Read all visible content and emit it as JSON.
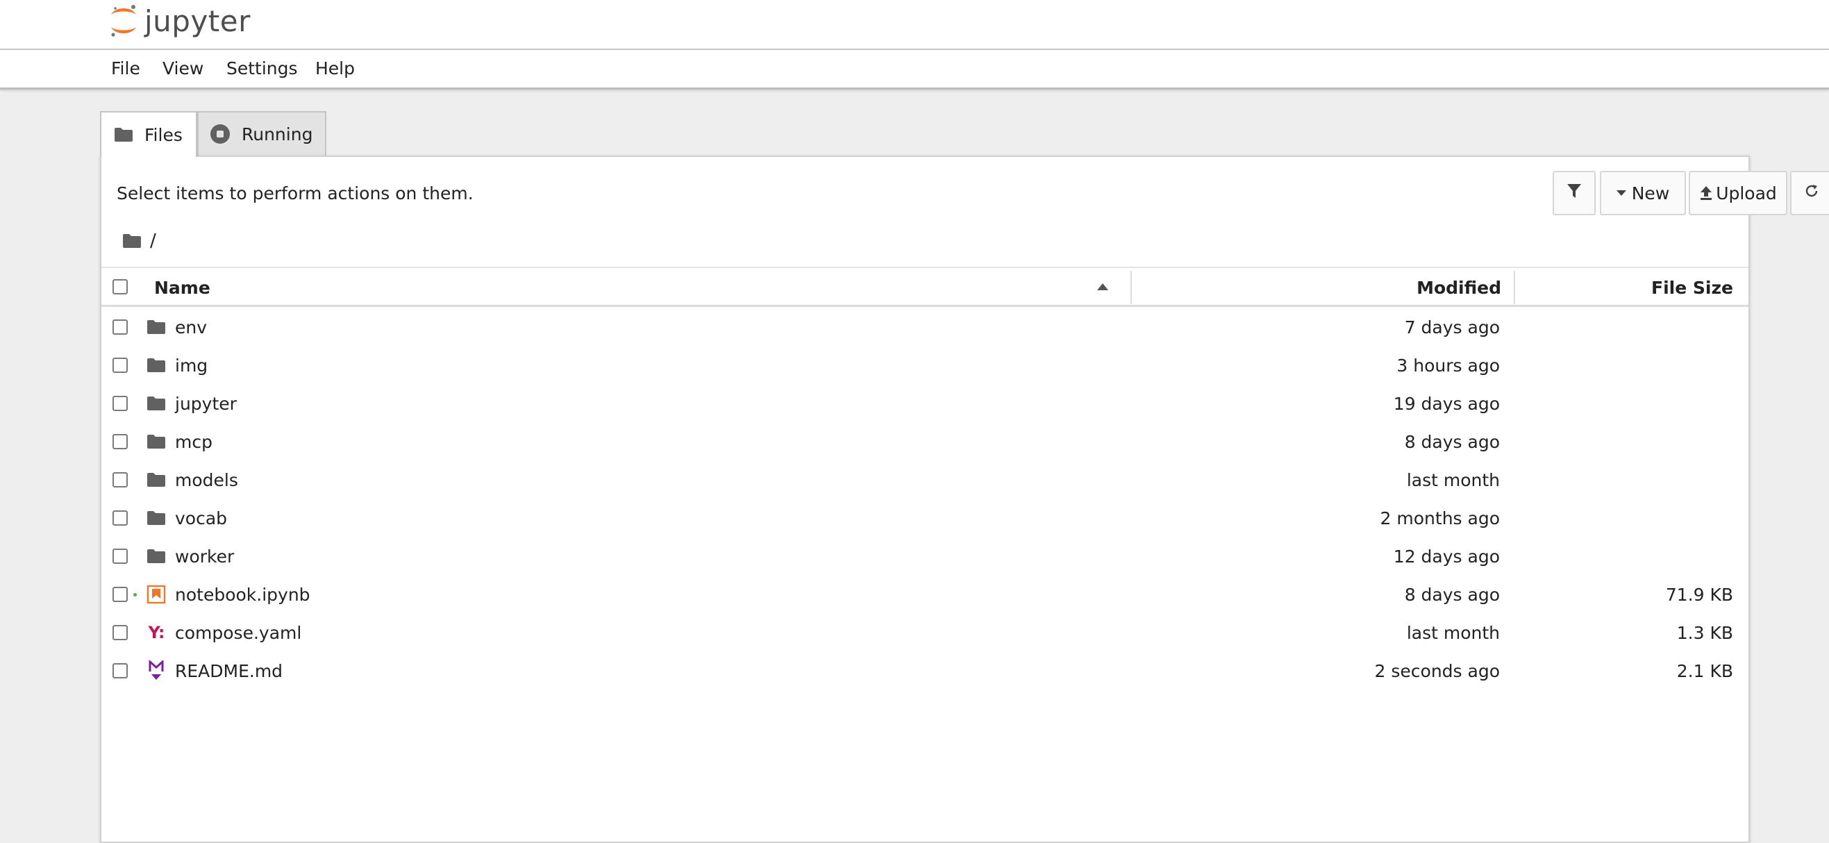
{
  "app": {
    "logo_text": "jupyter"
  },
  "menu": [
    "File",
    "View",
    "Settings",
    "Help"
  ],
  "tabs": [
    {
      "label": "Files",
      "icon": "folder-icon",
      "active": true
    },
    {
      "label": "Running",
      "icon": "stop-circle-icon",
      "active": false
    }
  ],
  "toolbar": {
    "hint": "Select items to perform actions on them.",
    "new_label": "New",
    "upload_label": "Upload"
  },
  "breadcrumb": {
    "path": "/"
  },
  "table": {
    "headers": {
      "name": "Name",
      "modified": "Modified",
      "size": "File Size"
    },
    "sort": {
      "column": "name",
      "direction": "ascending"
    },
    "rows": [
      {
        "name": "env",
        "modified": "7 days ago",
        "size": "",
        "type": "folder"
      },
      {
        "name": "img",
        "modified": "3 hours ago",
        "size": "",
        "type": "folder"
      },
      {
        "name": "jupyter",
        "modified": "19 days ago",
        "size": "",
        "type": "folder"
      },
      {
        "name": "mcp",
        "modified": "8 days ago",
        "size": "",
        "type": "folder"
      },
      {
        "name": "models",
        "modified": "last month",
        "size": "",
        "type": "folder"
      },
      {
        "name": "vocab",
        "modified": "2 months ago",
        "size": "",
        "type": "folder"
      },
      {
        "name": "worker",
        "modified": "12 days ago",
        "size": "",
        "type": "folder"
      },
      {
        "name": "notebook.ipynb",
        "modified": "8 days ago",
        "size": "71.9 KB",
        "type": "notebook",
        "running": true
      },
      {
        "name": "compose.yaml",
        "modified": "last month",
        "size": "1.3 KB",
        "type": "yaml"
      },
      {
        "name": "README.md",
        "modified": "2 seconds ago",
        "size": "2.1 KB",
        "type": "markdown"
      }
    ]
  },
  "colors": {
    "jupyter_orange": "#f37626",
    "folder_icon": "#616161",
    "yaml_icon": "#c2185b",
    "markdown_icon": "#7b1fa2",
    "running_indicator": "#4caf50"
  }
}
